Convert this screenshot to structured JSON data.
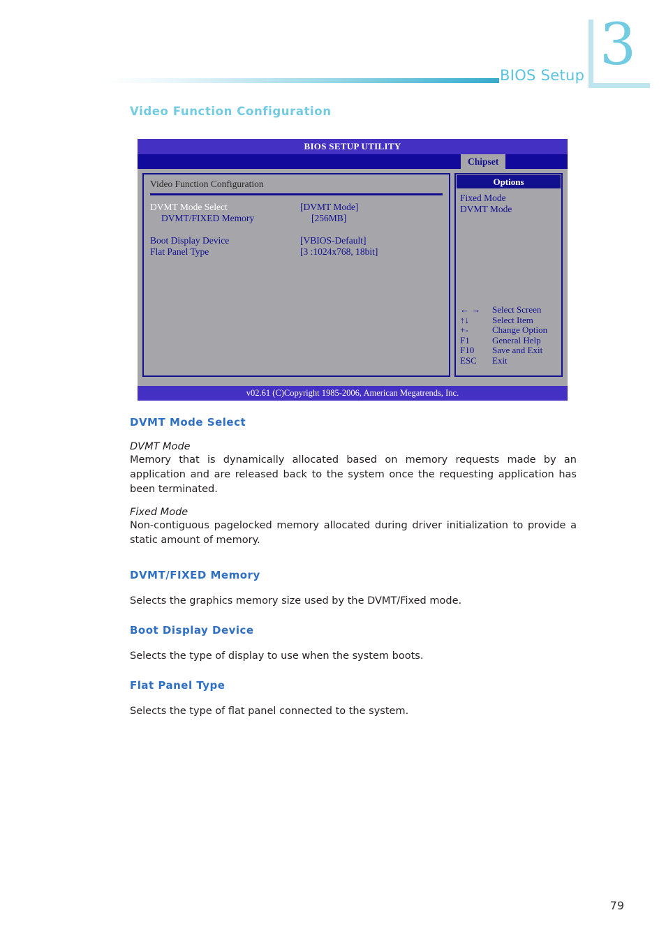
{
  "header": {
    "label": "BIOS Setup",
    "chapter_number": "3",
    "rule_color": "#4fb8d4",
    "label_color": "#5bc3dc"
  },
  "section_title": "Video Function Configuration",
  "bios": {
    "title": "BIOS SETUP UTILITY",
    "active_tab": "Chipset",
    "panel_heading": "Video Function Configuration",
    "settings": [
      {
        "label": "DVMT Mode Select",
        "value": "[DVMT Mode]",
        "selected": true,
        "indent": false
      },
      {
        "label": "DVMT/FIXED Memory",
        "value": "[256MB]",
        "selected": false,
        "indent": true
      },
      {
        "label": "Boot Display Device",
        "value": "[VBIOS-Default]",
        "selected": false,
        "indent": false
      },
      {
        "label": "Flat Panel Type",
        "value": "[3 :1024x768, 18bit]",
        "selected": false,
        "indent": false
      }
    ],
    "options_header": "Options",
    "options": [
      "Fixed Mode",
      "DVMT Mode"
    ],
    "nav_legend": [
      {
        "key": "← →",
        "desc": "Select Screen"
      },
      {
        "key": "↑↓",
        "desc": "Select Item"
      },
      {
        "key": "+-",
        "desc": "Change Option"
      },
      {
        "key": "F1",
        "desc": "General Help"
      },
      {
        "key": "F10",
        "desc": "Save and Exit"
      },
      {
        "key": "ESC",
        "desc": "Exit"
      }
    ],
    "footer": "v02.61 (C)Copyright 1985-2006, American Megatrends, Inc.",
    "colors": {
      "titlebar": "#4530c4",
      "menubar": "#120a9b",
      "body": "#a6a6aa",
      "text": "#12108f",
      "selected_text": "#ffffff"
    }
  },
  "content": {
    "dvmt_mode_select": {
      "heading": "DVMT Mode Select",
      "sub1": "DVMT Mode",
      "para1": "Memory that is dynamically allocated based on memory requests made by an application and are released back to the system once the requesting application has been terminated.",
      "sub2": "Fixed Mode",
      "para2": "Non-contiguous pagelocked memory allocated during driver initialization to provide a static amount of memory."
    },
    "dvmt_fixed_memory": {
      "heading": "DVMT/FIXED Memory",
      "para": "Selects the graphics memory size used by the DVMT/Fixed mode."
    },
    "boot_display_device": {
      "heading": "Boot Display Device",
      "para": "Selects the type of display to use when the system boots."
    },
    "flat_panel_type": {
      "heading": "Flat Panel Type",
      "para": "Selects the type of flat panel connected to the system."
    }
  },
  "page_number": "79"
}
